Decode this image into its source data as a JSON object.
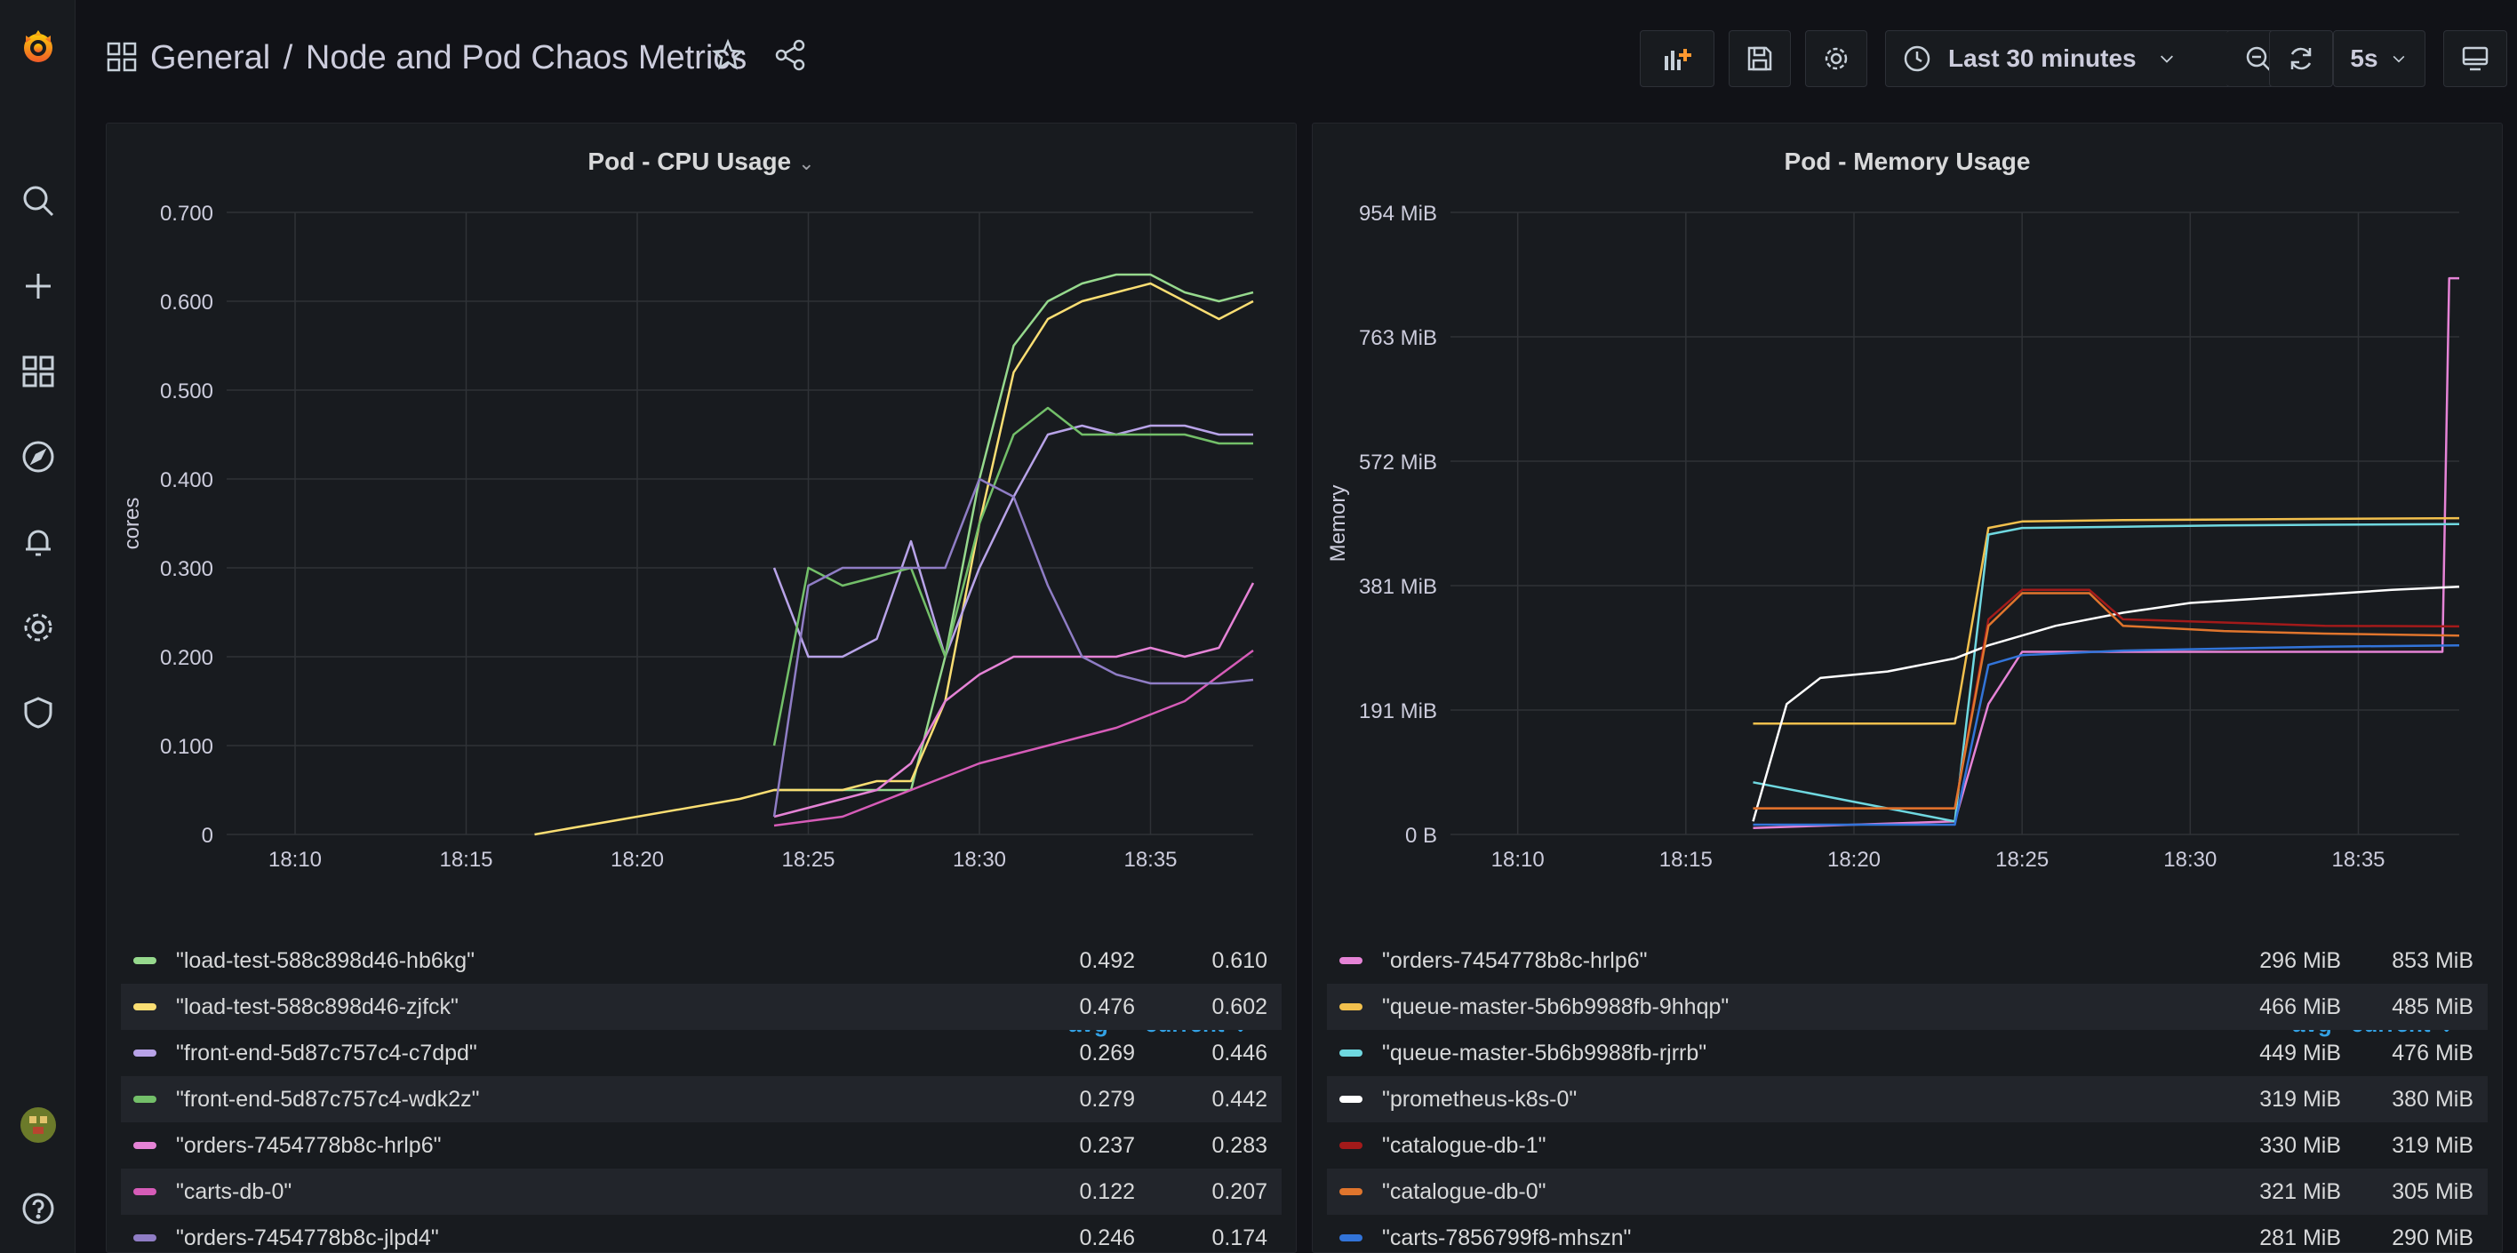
{
  "header": {
    "folder": "General",
    "separator": "/",
    "dashboard_title": "Node and Pod Chaos Metrics",
    "time_range": "Last 30 minutes",
    "refresh_interval": "5s"
  },
  "icons": {
    "sidebar": [
      "grafana-logo-icon",
      "search-icon",
      "plus-icon",
      "dashboards-grid-icon",
      "compass-explore-icon",
      "bell-alerting-icon",
      "gear-configuration-icon",
      "shield-admin-icon",
      "user-avatar-icon",
      "help-circle-icon"
    ],
    "toolbar": [
      "add-panel-icon",
      "save-icon",
      "settings-gear-icon",
      "clock-icon",
      "chevron-down-icon",
      "zoom-out-icon",
      "refresh-icon",
      "tv-mode-icon",
      "star-icon",
      "share-icon",
      "dashboard-grid-icon"
    ]
  },
  "colors": {
    "background": "#111217",
    "panel": "#181b1f",
    "accent_blue": "#33a2e5",
    "add_panel_orange": "#ff9830"
  },
  "panels": [
    {
      "title": "Pod - CPU Usage",
      "legend_headers": {
        "avg": "avg",
        "current": "current"
      },
      "legend": [
        {
          "name": "\"load-test-588c898d46-hb6kg\"",
          "color": "#96d98d",
          "avg": "0.492",
          "current": "0.610"
        },
        {
          "name": "\"load-test-588c898d46-zjfck\"",
          "color": "#fade73",
          "avg": "0.476",
          "current": "0.602"
        },
        {
          "name": "\"front-end-5d87c757c4-c7dpd\"",
          "color": "#b8a3e8",
          "avg": "0.269",
          "current": "0.446"
        },
        {
          "name": "\"front-end-5d87c757c4-wdk2z\"",
          "color": "#73bf69",
          "avg": "0.279",
          "current": "0.442"
        },
        {
          "name": "\"orders-7454778b8c-hrlp6\"",
          "color": "#e583d6",
          "avg": "0.237",
          "current": "0.283"
        },
        {
          "name": "\"carts-db-0\"",
          "color": "#d65cb8",
          "avg": "0.122",
          "current": "0.207"
        },
        {
          "name": "\"orders-7454778b8c-jlpd4\"",
          "color": "#8f7dc5",
          "avg": "0.246",
          "current": "0.174"
        }
      ]
    },
    {
      "title": "Pod - Memory Usage",
      "legend_headers": {
        "avg": "avg",
        "current": "current"
      },
      "legend": [
        {
          "name": "\"orders-7454778b8c-hrlp6\"",
          "color": "#e583d6",
          "avg": "296 MiB",
          "current": "853 MiB"
        },
        {
          "name": "\"queue-master-5b6b9988fb-9hhqp\"",
          "color": "#f2c04d",
          "avg": "466 MiB",
          "current": "485 MiB"
        },
        {
          "name": "\"queue-master-5b6b9988fb-rjrrb\"",
          "color": "#6fd8e0",
          "avg": "449 MiB",
          "current": "476 MiB"
        },
        {
          "name": "\"prometheus-k8s-0\"",
          "color": "#ffffff",
          "avg": "319 MiB",
          "current": "380 MiB"
        },
        {
          "name": "\"catalogue-db-1\"",
          "color": "#a31a1a",
          "avg": "330 MiB",
          "current": "319 MiB"
        },
        {
          "name": "\"catalogue-db-0\"",
          "color": "#e0752d",
          "avg": "321 MiB",
          "current": "305 MiB"
        },
        {
          "name": "\"carts-7856799f8-mhszn\"",
          "color": "#3274d9",
          "avg": "281 MiB",
          "current": "290 MiB"
        }
      ]
    }
  ],
  "chart_data": [
    {
      "type": "line",
      "title": "Pod - CPU Usage",
      "ylabel": "cores",
      "ylim": [
        0,
        0.7
      ],
      "yticks": [
        "0",
        "0.100",
        "0.200",
        "0.300",
        "0.400",
        "0.500",
        "0.600",
        "0.700"
      ],
      "xticks": [
        "18:10",
        "18:15",
        "18:20",
        "18:25",
        "18:30",
        "18:35"
      ],
      "xlim": [
        "18:08",
        "18:38"
      ],
      "grid": true,
      "legend_placement": "bottom",
      "series": [
        {
          "name": "\"load-test-588c898d46-hb6kg\"",
          "color": "#96d98d",
          "x": [
            "18:24",
            "18:25",
            "18:26",
            "18:27",
            "18:28",
            "18:29",
            "18:30",
            "18:31",
            "18:32",
            "18:33",
            "18:34",
            "18:35",
            "18:36",
            "18:37",
            "18:38"
          ],
          "y": [
            0.05,
            0.05,
            0.05,
            0.05,
            0.05,
            0.2,
            0.4,
            0.55,
            0.6,
            0.62,
            0.63,
            0.63,
            0.61,
            0.6,
            0.61
          ]
        },
        {
          "name": "\"load-test-588c898d46-zjfck\"",
          "color": "#fade73",
          "x": [
            "18:17",
            "18:20",
            "18:23",
            "18:24",
            "18:25",
            "18:26",
            "18:27",
            "18:28",
            "18:29",
            "18:30",
            "18:31",
            "18:32",
            "18:33",
            "18:34",
            "18:35",
            "18:36",
            "18:37",
            "18:38"
          ],
          "y": [
            0,
            0.02,
            0.04,
            0.05,
            0.05,
            0.05,
            0.06,
            0.06,
            0.15,
            0.35,
            0.52,
            0.58,
            0.6,
            0.61,
            0.62,
            0.6,
            0.58,
            0.6
          ]
        },
        {
          "name": "\"front-end-5d87c757c4-c7dpd\"",
          "color": "#b8a3e8",
          "x": [
            "18:24",
            "18:25",
            "18:26",
            "18:27",
            "18:28",
            "18:29",
            "18:30",
            "18:31",
            "18:32",
            "18:33",
            "18:34",
            "18:35",
            "18:36",
            "18:37",
            "18:38"
          ],
          "y": [
            0.3,
            0.2,
            0.2,
            0.22,
            0.33,
            0.2,
            0.3,
            0.38,
            0.45,
            0.46,
            0.45,
            0.46,
            0.46,
            0.45,
            0.45
          ]
        },
        {
          "name": "\"front-end-5d87c757c4-wdk2z\"",
          "color": "#73bf69",
          "x": [
            "18:24",
            "18:25",
            "18:26",
            "18:27",
            "18:28",
            "18:29",
            "18:30",
            "18:31",
            "18:32",
            "18:33",
            "18:34",
            "18:35",
            "18:36",
            "18:37",
            "18:38"
          ],
          "y": [
            0.1,
            0.3,
            0.28,
            0.29,
            0.3,
            0.2,
            0.35,
            0.45,
            0.48,
            0.45,
            0.45,
            0.45,
            0.45,
            0.44,
            0.44
          ]
        },
        {
          "name": "\"orders-7454778b8c-hrlp6\"",
          "color": "#e583d6",
          "x": [
            "18:24",
            "18:25",
            "18:26",
            "18:27",
            "18:28",
            "18:29",
            "18:30",
            "18:31",
            "18:32",
            "18:33",
            "18:34",
            "18:35",
            "18:36",
            "18:37",
            "18:38"
          ],
          "y": [
            0.02,
            0.03,
            0.04,
            0.05,
            0.08,
            0.15,
            0.18,
            0.2,
            0.2,
            0.2,
            0.2,
            0.21,
            0.2,
            0.21,
            0.283
          ]
        },
        {
          "name": "\"carts-db-0\"",
          "color": "#d65cb8",
          "x": [
            "18:24",
            "18:26",
            "18:28",
            "18:30",
            "18:32",
            "18:34",
            "18:36",
            "18:38"
          ],
          "y": [
            0.01,
            0.02,
            0.05,
            0.08,
            0.1,
            0.12,
            0.15,
            0.207
          ]
        },
        {
          "name": "\"orders-7454778b8c-jlpd4\"",
          "color": "#8f7dc5",
          "x": [
            "18:24",
            "18:25",
            "18:26",
            "18:27",
            "18:28",
            "18:29",
            "18:30",
            "18:31",
            "18:32",
            "18:33",
            "18:34",
            "18:35",
            "18:36",
            "18:37",
            "18:38"
          ],
          "y": [
            0.02,
            0.28,
            0.3,
            0.3,
            0.3,
            0.3,
            0.4,
            0.38,
            0.28,
            0.2,
            0.18,
            0.17,
            0.17,
            0.17,
            0.174
          ]
        }
      ]
    },
    {
      "type": "line",
      "title": "Pod - Memory Usage",
      "ylabel": "Memory",
      "ylim": [
        0,
        954
      ],
      "yticks": [
        "0 B",
        "191 MiB",
        "381 MiB",
        "572 MiB",
        "763 MiB",
        "954 MiB"
      ],
      "xticks": [
        "18:10",
        "18:15",
        "18:20",
        "18:25",
        "18:30",
        "18:35"
      ],
      "xlim": [
        "18:08",
        "18:38"
      ],
      "grid": true,
      "legend_placement": "bottom",
      "series": [
        {
          "name": "\"orders-7454778b8c-hrlp6\"",
          "color": "#e583d6",
          "x": [
            "18:17",
            "18:23",
            "18:24",
            "18:25",
            "18:28",
            "18:31",
            "18:34",
            "18:37.5",
            "18:37.7",
            "18:38"
          ],
          "y": [
            10,
            20,
            200,
            280,
            280,
            280,
            280,
            280,
            853,
            853
          ]
        },
        {
          "name": "\"queue-master-5b6b9988fb-9hhqp\"",
          "color": "#f2c04d",
          "x": [
            "18:17",
            "18:23",
            "18:24",
            "18:25",
            "18:28",
            "18:31",
            "18:34",
            "18:38"
          ],
          "y": [
            170,
            170,
            470,
            480,
            482,
            483,
            484,
            485
          ]
        },
        {
          "name": "\"queue-master-5b6b9988fb-rjrrb\"",
          "color": "#6fd8e0",
          "x": [
            "18:17",
            "18:23",
            "18:24",
            "18:25",
            "18:28",
            "18:31",
            "18:34",
            "18:38"
          ],
          "y": [
            80,
            20,
            460,
            470,
            472,
            474,
            475,
            476
          ]
        },
        {
          "name": "\"prometheus-k8s-0\"",
          "color": "#ffffff",
          "x": [
            "18:17",
            "18:18",
            "18:19",
            "18:21",
            "18:23",
            "18:24",
            "18:26",
            "18:28",
            "18:30",
            "18:33",
            "18:36",
            "18:38"
          ],
          "y": [
            20,
            200,
            240,
            250,
            270,
            290,
            320,
            340,
            355,
            365,
            375,
            380
          ]
        },
        {
          "name": "\"catalogue-db-1\"",
          "color": "#a31a1a",
          "x": [
            "18:17",
            "18:23",
            "18:24",
            "18:25",
            "18:27",
            "18:28",
            "18:31",
            "18:34",
            "18:38"
          ],
          "y": [
            40,
            40,
            330,
            375,
            375,
            330,
            325,
            320,
            319
          ]
        },
        {
          "name": "\"catalogue-db-0\"",
          "color": "#e0752d",
          "x": [
            "18:17",
            "18:23",
            "18:24",
            "18:25",
            "18:27",
            "18:28",
            "18:31",
            "18:34",
            "18:38"
          ],
          "y": [
            40,
            40,
            320,
            370,
            370,
            320,
            312,
            308,
            305
          ]
        },
        {
          "name": "\"carts-7856799f8-mhszn\"",
          "color": "#3274d9",
          "x": [
            "18:17",
            "18:23",
            "18:24",
            "18:25",
            "18:28",
            "18:31",
            "18:34",
            "18:38"
          ],
          "y": [
            15,
            15,
            260,
            275,
            282,
            285,
            288,
            290
          ]
        }
      ]
    }
  ]
}
